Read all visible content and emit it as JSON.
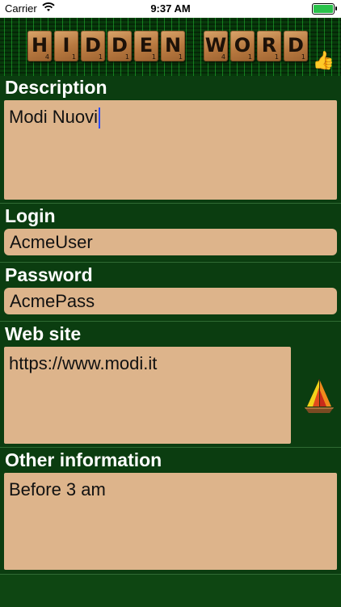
{
  "status_bar": {
    "carrier": "Carrier",
    "time": "9:37 AM",
    "wifi_icon": "wifi-icon",
    "battery_icon": "battery-icon"
  },
  "header": {
    "title_word1": [
      {
        "letter": "H",
        "points": "4"
      },
      {
        "letter": "I",
        "points": "1"
      },
      {
        "letter": "D",
        "points": "1"
      },
      {
        "letter": "D",
        "points": "1"
      },
      {
        "letter": "E",
        "points": "1"
      },
      {
        "letter": "N",
        "points": "1"
      }
    ],
    "title_word2": [
      {
        "letter": "W",
        "points": "4"
      },
      {
        "letter": "O",
        "points": "1"
      },
      {
        "letter": "R",
        "points": "1"
      },
      {
        "letter": "D",
        "points": "1"
      }
    ],
    "thumbs_icon": "👍"
  },
  "sections": {
    "description": {
      "label": "Description",
      "value": "Modi Nuovi"
    },
    "login": {
      "label": "Login",
      "value": "AcmeUser"
    },
    "password": {
      "label": "Password",
      "value": "AcmePass"
    },
    "website": {
      "label": "Web site",
      "value": "https://www.modi.it",
      "icon": "sailboat-icon"
    },
    "other": {
      "label": "Other information",
      "value": "Before 3 am"
    }
  },
  "colors": {
    "background": "#0b3d10",
    "field": "#ddb48b",
    "cursor": "#2a4bff",
    "label": "#ffffff"
  }
}
